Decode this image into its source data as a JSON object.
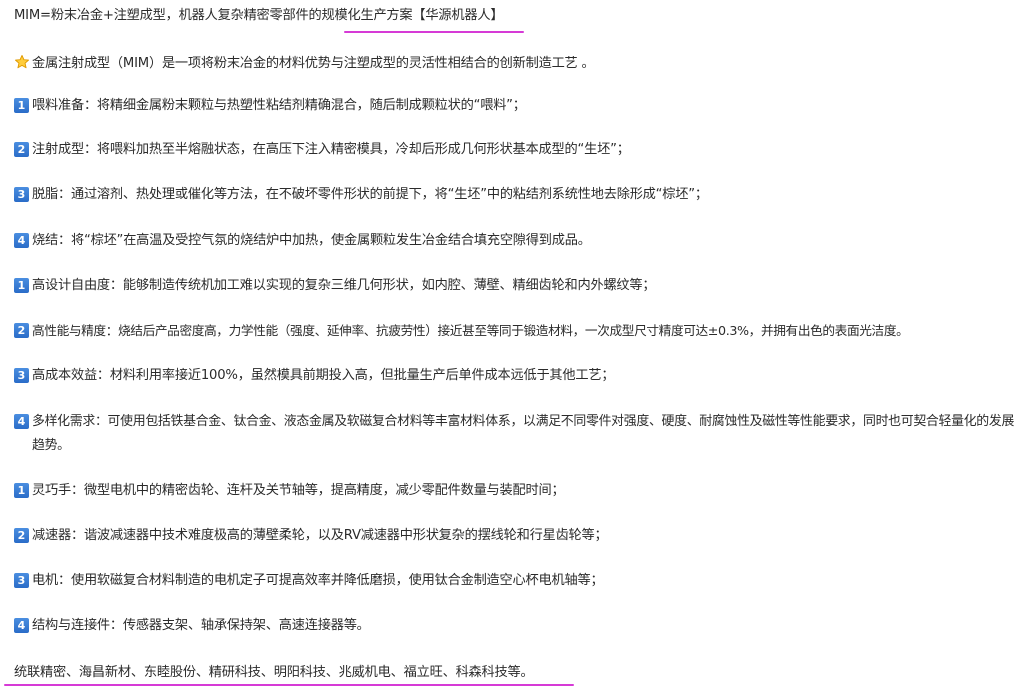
{
  "title": "MIM=粉末冶金+注塑成型，机器人复杂精密零部件的规模化生产方案【华源机器人】",
  "intro": "金属注射成型（MIM）是一项将粉末冶金的材料优势与注塑成型的灵活性相结合的创新制造工艺 。",
  "icons": {
    "intro": "star-icon",
    "numbers": "keycap-number-icon"
  },
  "colors": {
    "underline": "#d63ad6",
    "keycap": "#2a6cc8",
    "text": "#2b2b2b"
  },
  "sections": [
    {
      "num": "1",
      "text": "喂料准备：将精细金属粉末颗粒与热塑性粘结剂精确混合，随后制成颗粒状的“喂料”；"
    },
    {
      "num": "2",
      "text": "注射成型：将喂料加热至半熔融状态，在高压下注入精密模具，冷却后形成几何形状基本成型的“生坯”；"
    },
    {
      "num": "3",
      "text": "脱脂：通过溶剂、热处理或催化等方法，在不破坏零件形状的前提下，将“生坯”中的粘结剂系统性地去除形成“棕坯”；"
    },
    {
      "num": "4",
      "text": "烧结：将“棕坯”在高温及受控气氛的烧结炉中加热，使金属颗粒发生冶金结合填充空隙得到成品。"
    },
    {
      "num": "1",
      "text": "高设计自由度：能够制造传统机加工难以实现的复杂三维几何形状，如内腔、薄壁、精细齿轮和内外螺纹等；"
    },
    {
      "num": "2",
      "text": "高性能与精度：烧结后产品密度高，力学性能（强度、延伸率、抗疲劳性）接近甚至等同于锻造材料，一次成型尺寸精度可达±0.3%，并拥有出色的表面光洁度。"
    },
    {
      "num": "3",
      "text": "高成本效益：材料利用率接近100%，虽然模具前期投入高，但批量生产后单件成本远低于其他工艺；"
    },
    {
      "num": "4",
      "text": "多样化需求：可使用包括铁基合金、钛合金、液态金属及软磁复合材料等丰富材料体系，以满足不同零件对强度、硬度、耐腐蚀性及磁性等性能要求，同时也可契合轻量化的发展趋势。"
    },
    {
      "num": "1",
      "text": "灵巧手：微型电机中的精密齿轮、连杆及关节轴等，提高精度，减少零配件数量与装配时间；"
    },
    {
      "num": "2",
      "text": "减速器：谐波减速器中技术难度极高的薄壁柔轮，以及RV减速器中形状复杂的摆线轮和行星齿轮等；"
    },
    {
      "num": "3",
      "text": "电机：使用软磁复合材料制造的电机定子可提高效率并降低磨损，使用钛合金制造空心杯电机轴等；"
    },
    {
      "num": "4",
      "text": "结构与连接件：传感器支架、轴承保持架、高速连接器等。"
    }
  ],
  "companies": "统联精密、海昌新材、东睦股份、精研科技、明阳科技、兆威机电、福立旺、科森科技等。"
}
